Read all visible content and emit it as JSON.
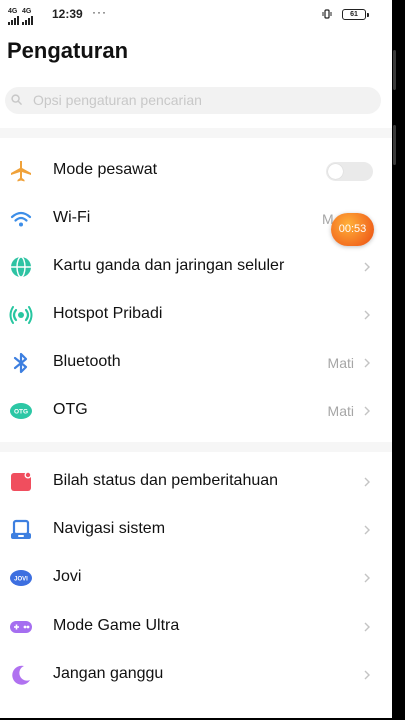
{
  "status_bar": {
    "network_1": "4G",
    "network_2": "4G",
    "time": "12:39",
    "more": "···",
    "battery": "61"
  },
  "page_title": "Pengaturan",
  "search": {
    "placeholder": "Opsi pengaturan pencarian"
  },
  "recording_timer": "00:53",
  "group1": [
    {
      "label": "Mode pesawat",
      "icon": "airplane-icon",
      "control": "toggle",
      "toggle_on": false
    },
    {
      "label": "Wi-Fi",
      "icon": "wifi-icon",
      "value": "M"
    },
    {
      "label": "Kartu ganda dan jaringan seluler",
      "icon": "globe-icon"
    },
    {
      "label": "Hotspot Pribadi",
      "icon": "hotspot-icon"
    },
    {
      "label": "Bluetooth",
      "icon": "bluetooth-icon",
      "value": "Mati"
    },
    {
      "label": "OTG",
      "icon": "otg-icon",
      "icon_text": "OTG",
      "value": "Mati"
    }
  ],
  "group2": [
    {
      "label": "Bilah status dan pemberitahuan",
      "icon": "status-bar-icon"
    },
    {
      "label": "Navigasi sistem",
      "icon": "navigation-icon"
    },
    {
      "label": "Jovi",
      "icon": "jovi-icon",
      "icon_text": "JOVI"
    },
    {
      "label": "Mode Game Ultra",
      "icon": "gamepad-icon"
    },
    {
      "label": "Jangan ganggu",
      "icon": "moon-icon"
    }
  ],
  "colors": {
    "airplane": "#f0a23a",
    "wifi": "#3d8ee8",
    "globe": "#2ec3a3",
    "hotspot": "#27c6a0",
    "bluetooth": "#3d7fe0",
    "otg": "#2cc7a5",
    "status_bar": "#f04e5e",
    "navigation": "#3d7fe0",
    "jovi": "#3d6fe0",
    "gamepad": "#a56ef0",
    "moon": "#b071f0",
    "timer": "#f26a1e"
  }
}
